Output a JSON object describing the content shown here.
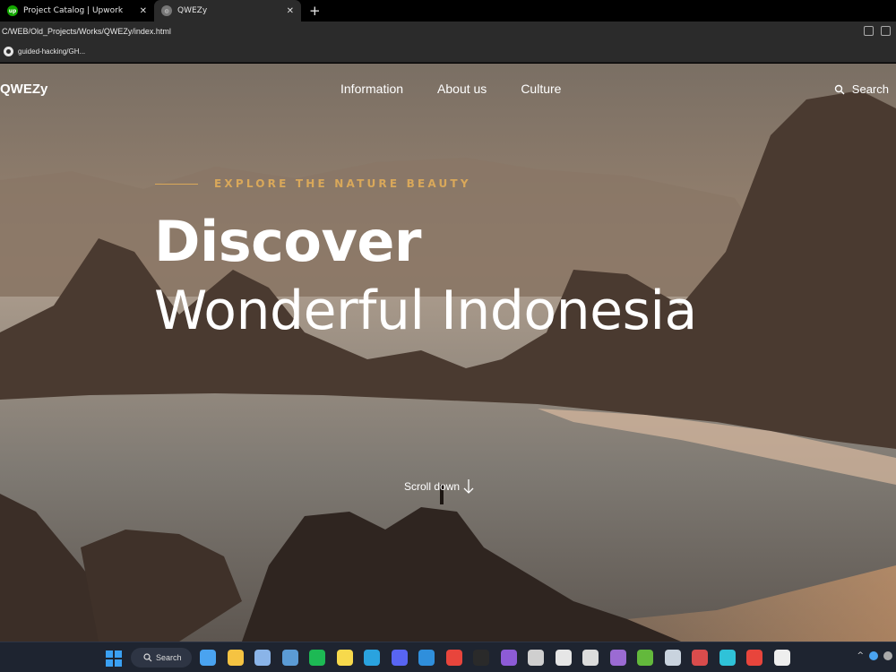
{
  "browser": {
    "tabs": [
      {
        "label": "Project Catalog | Upwork",
        "favicon": "upwork-icon",
        "active": false
      },
      {
        "label": "QWEZy",
        "favicon": "globe-icon",
        "active": true
      }
    ],
    "url": "C/WEB/Old_Projects/Works/QWEZy/index.html",
    "bookmarks": [
      {
        "label": "guided-hacking/GH..."
      }
    ]
  },
  "site": {
    "logo": "QWEZy",
    "nav": [
      {
        "label": "Information"
      },
      {
        "label": "About us"
      },
      {
        "label": "Culture"
      }
    ],
    "search_label": "Search"
  },
  "hero": {
    "eyebrow": "EXPLORE THE NATURE BEAUTY",
    "title_bold": "Discover",
    "title_light": "Wonderful Indonesia",
    "scroll_label": "Scroll down"
  },
  "taskbar": {
    "search_label": "Search",
    "apps": [
      {
        "icon": "desktop-icon",
        "color": "#4aa3f0"
      },
      {
        "icon": "file-explorer-icon",
        "color": "#f5c342"
      },
      {
        "icon": "photos-icon",
        "color": "#8ab4e8"
      },
      {
        "icon": "remote-desktop-icon",
        "color": "#5b9bd5"
      },
      {
        "icon": "spotify-icon",
        "color": "#1db954"
      },
      {
        "icon": "sticky-notes-icon",
        "color": "#f7d94c"
      },
      {
        "icon": "telegram-icon",
        "color": "#2aa3df"
      },
      {
        "icon": "discord-icon",
        "color": "#5865f2"
      },
      {
        "icon": "vscode-icon",
        "color": "#2f8fdc"
      },
      {
        "icon": "chrome-icon",
        "color": "#e8453c"
      },
      {
        "icon": "epic-games-icon",
        "color": "#2a2a2a"
      },
      {
        "icon": "visual-studio-icon",
        "color": "#8d5bd6"
      },
      {
        "icon": "unity-icon",
        "color": "#cfcfcf"
      },
      {
        "icon": "inkscape-icon",
        "color": "#e6e6e6"
      },
      {
        "icon": "ableton-live-icon",
        "color": "#dcdcdc"
      },
      {
        "icon": "app-icon",
        "color": "#9b6bd3"
      },
      {
        "icon": "utorrent-icon",
        "color": "#63b93c"
      },
      {
        "icon": "steam-icon",
        "color": "#c9d3de"
      },
      {
        "icon": "app-icon-2",
        "color": "#d94c4c"
      },
      {
        "icon": "webstorm-icon",
        "color": "#2fc2d8"
      },
      {
        "icon": "chrome-active-icon",
        "color": "#e8453c"
      },
      {
        "icon": "7zip-icon",
        "color": "#eeeeee"
      }
    ]
  }
}
